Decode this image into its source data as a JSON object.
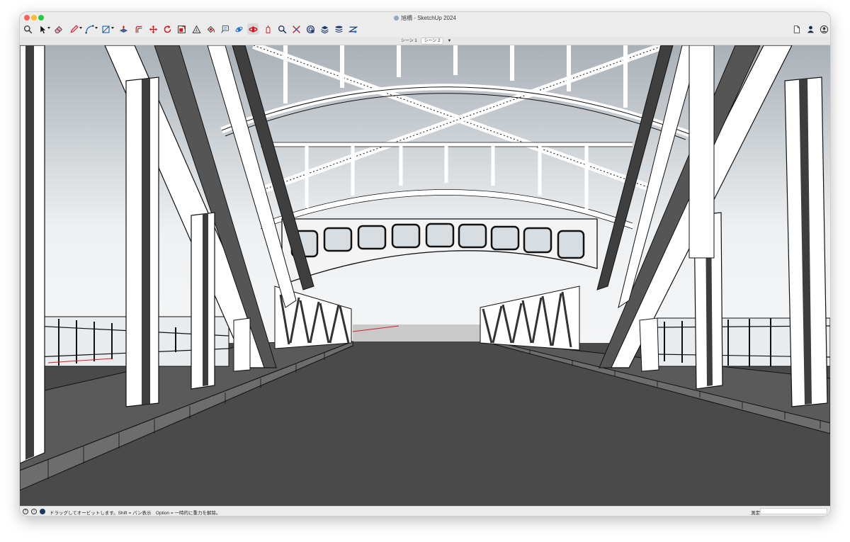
{
  "window": {
    "title": "旭橋 - SketchUp 2024"
  },
  "toolbar": {
    "tools": [
      {
        "name": "search-tool",
        "icon": "magnifier-icon"
      },
      {
        "name": "select-tool",
        "icon": "arrow-cursor-icon",
        "dropdown": true
      },
      {
        "name": "eraser-tool",
        "icon": "eraser-icon"
      },
      {
        "name": "line-tool",
        "icon": "pencil-icon",
        "dropdown": true
      },
      {
        "name": "arc-tool",
        "icon": "arc-icon",
        "dropdown": true
      },
      {
        "name": "shape-tool",
        "icon": "rectangle-icon",
        "dropdown": true
      },
      {
        "name": "push-pull-tool",
        "icon": "push-pull-icon"
      },
      {
        "name": "offset-tool",
        "icon": "offset-icon"
      },
      {
        "name": "move-tool",
        "icon": "move-cross-icon"
      },
      {
        "name": "rotate-tool",
        "icon": "rotate-icon"
      },
      {
        "name": "scale-tool",
        "icon": "scale-icon"
      },
      {
        "name": "tape-measure-tool",
        "icon": "tape-measure-icon"
      },
      {
        "name": "paint-bucket-tool",
        "icon": "paint-bucket-icon"
      },
      {
        "name": "text-tool",
        "icon": "text-balloon-icon"
      },
      {
        "name": "orbit-tool",
        "icon": "orbit-icon"
      },
      {
        "name": "pan-tool",
        "icon": "pan-hand-icon",
        "active": true
      },
      {
        "name": "zoom-tool",
        "icon": "zoom-icon"
      },
      {
        "name": "zoom-extents-tool",
        "icon": "zoom-extents-icon"
      },
      {
        "name": "warehouse-tool",
        "icon": "globe-icon"
      },
      {
        "name": "extension-warehouse-tool",
        "icon": "extension-icon"
      },
      {
        "name": "layers-tool",
        "icon": "layers-icon"
      },
      {
        "name": "trimble-connect-tool",
        "icon": "connect-icon"
      }
    ],
    "right": [
      {
        "name": "document-button",
        "icon": "document-icon"
      },
      {
        "name": "account-button",
        "icon": "person-icon"
      },
      {
        "name": "profile-button",
        "icon": "user-circle-icon"
      }
    ]
  },
  "scenes": {
    "tabs": [
      {
        "label": "シーン 1",
        "selected": false
      },
      {
        "label": "シーン 2",
        "selected": true
      }
    ],
    "menu_glyph": "▼"
  },
  "status": {
    "message": "ドラッグしてオービットします。Shift = パン表示　Option = 一時的に重力を解除。",
    "measurement_label": "測定",
    "measurement_value": ""
  },
  "colors": {
    "sky_top": "#a9b0b6",
    "sky_horizon": "#eef1f3",
    "ground": "#4a4a4a",
    "steel_face": "#ffffff",
    "steel_shadow": "#6b6b6b",
    "steel_dark": "#3f3f3f",
    "accent_red": "#d81e1e"
  }
}
